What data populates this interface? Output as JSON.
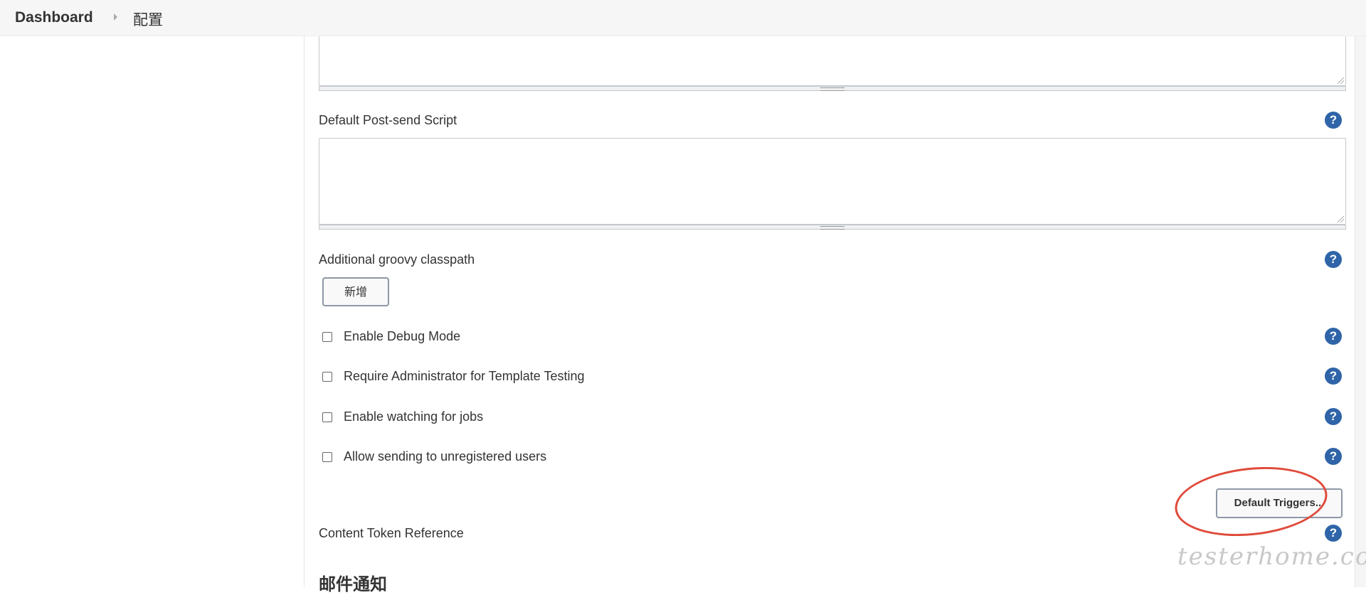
{
  "breadcrumb": {
    "root": "Dashboard",
    "current": "配置"
  },
  "fields": {
    "post_send_script_label": "Default Post-send Script",
    "groovy_classpath_label": "Additional groovy classpath",
    "add_button_label": "新增",
    "content_token_label": "Content Token Reference"
  },
  "checkboxes": [
    {
      "label": "Enable Debug Mode",
      "checked": false
    },
    {
      "label": "Require Administrator for Template Testing",
      "checked": false
    },
    {
      "label": "Enable watching for jobs",
      "checked": false
    },
    {
      "label": "Allow sending to unregistered users",
      "checked": false
    }
  ],
  "buttons": {
    "default_triggers": "Default Triggers..."
  },
  "section": {
    "heading": "邮件通知"
  },
  "watermark": "testerhome.com",
  "colors": {
    "help_icon": "#2f64a8",
    "annotation": "#e04a3a"
  },
  "icons": {
    "help": "question-icon"
  }
}
